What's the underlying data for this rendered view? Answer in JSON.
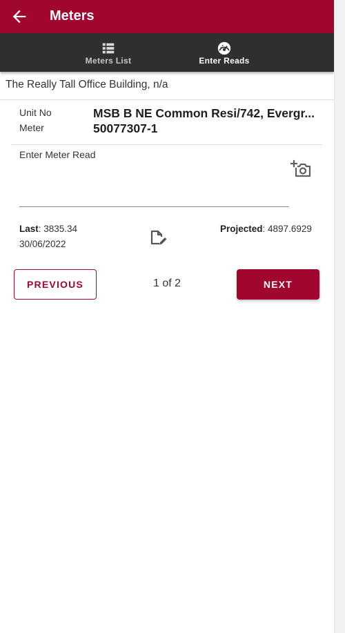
{
  "appbar": {
    "title": "Meters",
    "back_icon": "arrow-left-icon"
  },
  "tabs": [
    {
      "label": "Meters List",
      "icon": "table-list-icon",
      "active": false
    },
    {
      "label": "Enter Reads",
      "icon": "speedometer-icon",
      "active": true
    }
  ],
  "location": "The Really Tall Office Building, n/a",
  "meter": {
    "unit_label": "Unit No",
    "unit_value": "MSB B NE Common Resi/742, Evergr...",
    "meter_label": "Meter",
    "meter_value": "50077307-1"
  },
  "read": {
    "label": "Enter Meter Read",
    "value": "",
    "camera_icon": "add-photo-camera-icon"
  },
  "stats": {
    "last_label": "Last",
    "last_value": ": 3835.34",
    "last_date": "30/06/2022",
    "edit_icon": "edit-note-icon",
    "projected_label": "Projected",
    "projected_value": ": 4897.6929"
  },
  "pagination": {
    "previous_label": "PREVIOUS",
    "page_text": "1 of 2",
    "next_label": "NEXT"
  },
  "colors": {
    "brand": "#a1062e",
    "tabbar": "#2f2f2f",
    "divider": "#dddddd"
  }
}
